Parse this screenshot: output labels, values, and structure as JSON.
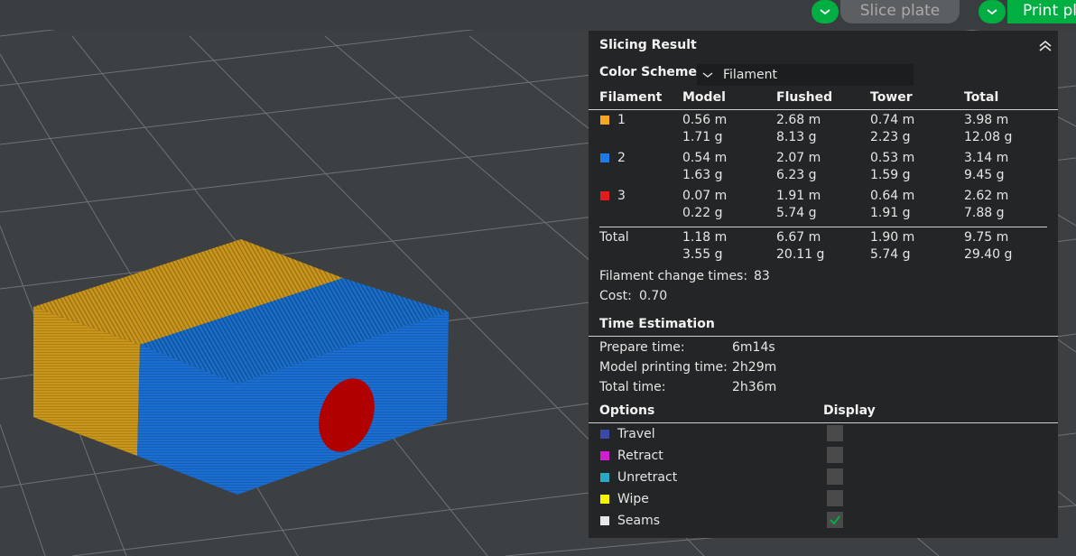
{
  "toolbar": {
    "slice_label": "Slice plate",
    "print_label": "Print pl",
    "accent": "#00ae42"
  },
  "panel": {
    "title": "Slicing Result",
    "color_scheme": {
      "label": "Color Scheme",
      "value": "Filament"
    },
    "table": {
      "headers": [
        "Filament",
        "Model",
        "Flushed",
        "Tower",
        "Total"
      ],
      "rows": [
        {
          "id": "1",
          "color": "#f5a623",
          "model": [
            "0.56 m",
            "1.71 g"
          ],
          "flushed": [
            "2.68 m",
            "8.13 g"
          ],
          "tower": [
            "0.74 m",
            "2.23 g"
          ],
          "total": [
            "3.98 m",
            "12.08 g"
          ]
        },
        {
          "id": "2",
          "color": "#1e7be6",
          "model": [
            "0.54 m",
            "1.63 g"
          ],
          "flushed": [
            "2.07 m",
            "6.23 g"
          ],
          "tower": [
            "0.53 m",
            "1.59 g"
          ],
          "total": [
            "3.14 m",
            "9.45 g"
          ]
        },
        {
          "id": "3",
          "color": "#e41b1b",
          "model": [
            "0.07 m",
            "0.22 g"
          ],
          "flushed": [
            "1.91 m",
            "5.74 g"
          ],
          "tower": [
            "0.64 m",
            "1.91 g"
          ],
          "total": [
            "2.62 m",
            "7.88 g"
          ]
        }
      ],
      "total_row": {
        "label": "Total",
        "model": [
          "1.18 m",
          "3.55 g"
        ],
        "flushed": [
          "6.67 m",
          "20.11 g"
        ],
        "tower": [
          "1.90 m",
          "5.74 g"
        ],
        "total": [
          "9.75 m",
          "29.40 g"
        ]
      }
    },
    "filament_change": {
      "label": "Filament change times:",
      "value": "83"
    },
    "cost": {
      "label": "Cost:",
      "value": "0.70"
    },
    "time_estimation": {
      "title": "Time Estimation",
      "rows": [
        {
          "label": "Prepare time:",
          "value": "6m14s"
        },
        {
          "label": "Model printing time:",
          "value": "2h29m"
        },
        {
          "label": "Total time:",
          "value": "2h36m"
        }
      ]
    },
    "options": {
      "title": "Options",
      "display_title": "Display",
      "items": [
        {
          "label": "Travel",
          "color": "#3b4aa8",
          "checked": false
        },
        {
          "label": "Retract",
          "color": "#d21ed2",
          "checked": false
        },
        {
          "label": "Unretract",
          "color": "#2aa8c8",
          "checked": false
        },
        {
          "label": "Wipe",
          "color": "#f5f500",
          "checked": false
        },
        {
          "label": "Seams",
          "color": "#e8e8e8",
          "checked": true
        }
      ]
    }
  }
}
